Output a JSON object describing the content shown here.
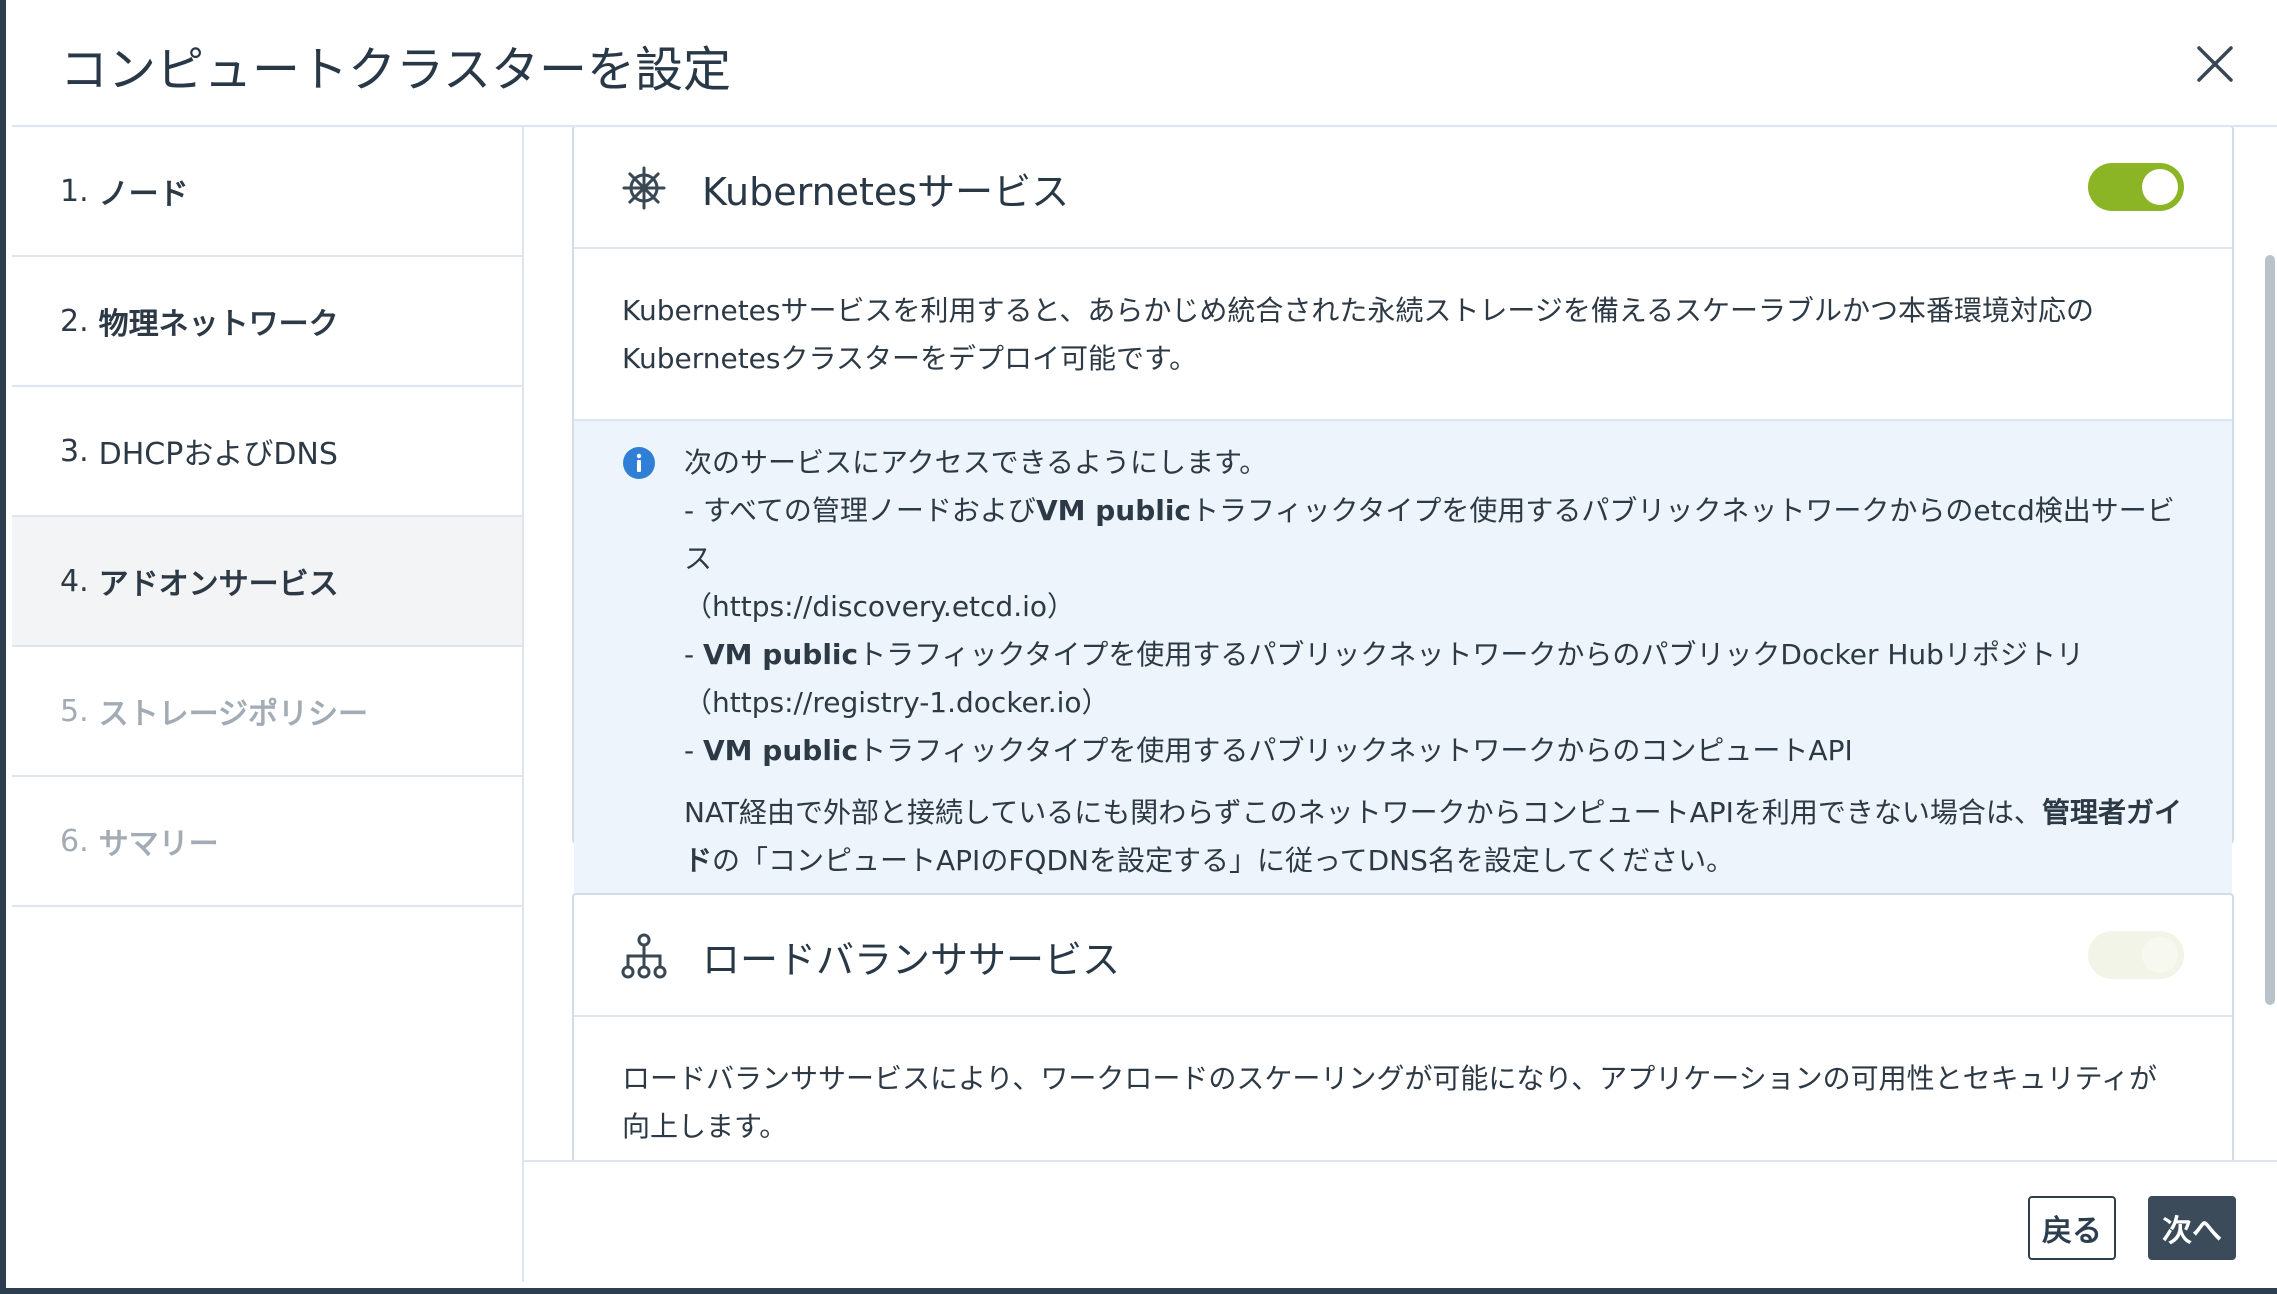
{
  "dialog": {
    "title": "コンピュートクラスターを設定"
  },
  "steps": [
    {
      "num": "1.",
      "label": "ノード",
      "state": "done"
    },
    {
      "num": "2.",
      "label": "物理ネットワーク",
      "state": "done"
    },
    {
      "num": "3.",
      "label": "DHCPおよびDNS",
      "state": "done"
    },
    {
      "num": "4.",
      "label": "アドオンサービス",
      "state": "active"
    },
    {
      "num": "5.",
      "label": "ストレージポリシー",
      "state": "disabled"
    },
    {
      "num": "6.",
      "label": "サマリー",
      "state": "disabled"
    }
  ],
  "kubernetes": {
    "title": "Kubernetesサービス",
    "enabled": true,
    "description_line1": "Kubernetesサービスを利用すると、あらかじめ統合された永続ストレージを備えるスケーラブルかつ本番環境対応の",
    "description_line2": "Kubernetesクラスターをデプロイ可能です。",
    "info": {
      "intro": "次のサービスにアクセスできるようにします。",
      "item1_prefix": "- すべての管理ノードおよび",
      "item1_bold": "VM public",
      "item1_suffix": "トラフィックタイプを使用するパブリックネットワークからのetcd検出サービス",
      "item1_url": "（https://discovery.etcd.io）",
      "item2_prefix": "- ",
      "item2_bold": "VM public",
      "item2_suffix": "トラフィックタイプを使用するパブリックネットワークからのパブリックDocker Hubリポジトリ",
      "item2_url": "（https://registry-1.docker.io）",
      "item3_prefix": "- ",
      "item3_bold": "VM public",
      "item3_suffix": "トラフィックタイプを使用するパブリックネットワークからのコンピュートAPI",
      "note_prefix": "NAT経由で外部と接続しているにも関わらずこのネットワークからコンピュートAPIを利用できない場合は、",
      "note_bold1": "管理者ガイ",
      "note_bold2": "ド",
      "note_suffix": "の「コンピュートAPIのFQDNを設定する」に従ってDNS名を設定してください。"
    }
  },
  "loadbalancer": {
    "title": "ロードバランササービス",
    "enabled": false,
    "description_line1": "ロードバランササービスにより、ワークロードのスケーリングが可能になり、アプリケーションの可用性とセキュリティが",
    "description_line2": "向上します。"
  },
  "footer": {
    "back_label": "戻る",
    "next_label": "次へ"
  },
  "colors": {
    "toggle_on": "#8cb526",
    "info_bg": "#edf4fb",
    "primary_button": "#3c4b59",
    "info_icon": "#2f7fd6"
  }
}
